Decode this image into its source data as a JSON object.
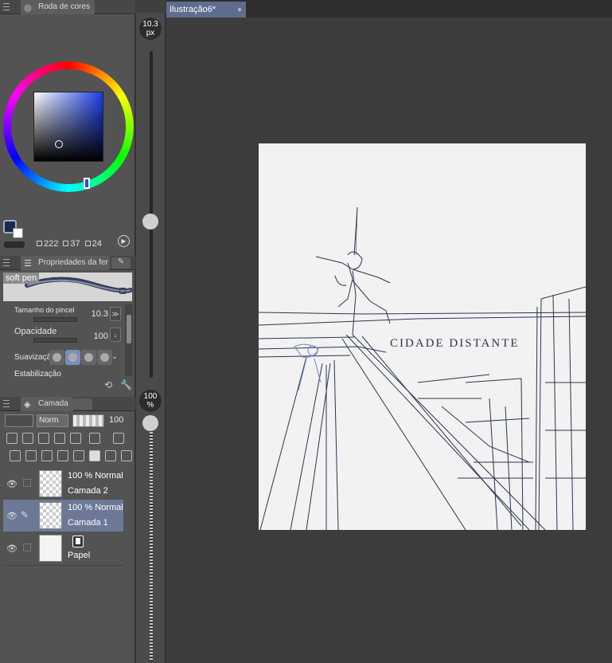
{
  "color_panel": {
    "title": "Roda de cores",
    "counts": [
      "222",
      "37",
      "24"
    ]
  },
  "tool_props": {
    "title": "Propriedades da fer",
    "brush_name": "soft pen",
    "size_label": "Tamanho do pincel",
    "size_value": "10.3",
    "opacity_label": "Opacidade",
    "opacity_value": "100",
    "smooth_label": "Suavização",
    "stabilize_label": "Estabilização"
  },
  "layer_panel": {
    "title": "Camada",
    "blend_mode": "Norm",
    "opacity": "100",
    "layers": [
      {
        "mode": "100 % Normal",
        "name": "Camada 2"
      },
      {
        "mode": "100 % Normal",
        "name": "Camada 1"
      },
      {
        "mode": "",
        "name": "Papel"
      }
    ]
  },
  "slider": {
    "size_line1": "10.3",
    "size_line2": "px",
    "opacity_line1": "100",
    "opacity_line2": "%"
  },
  "document": {
    "tab_label": "Ilustração6*"
  },
  "canvas_text": "CIDADE DISTANTE",
  "colors": {
    "accent": "#5e6d8f",
    "selection": "#6c7896",
    "main_color": "#1b2a4a"
  }
}
